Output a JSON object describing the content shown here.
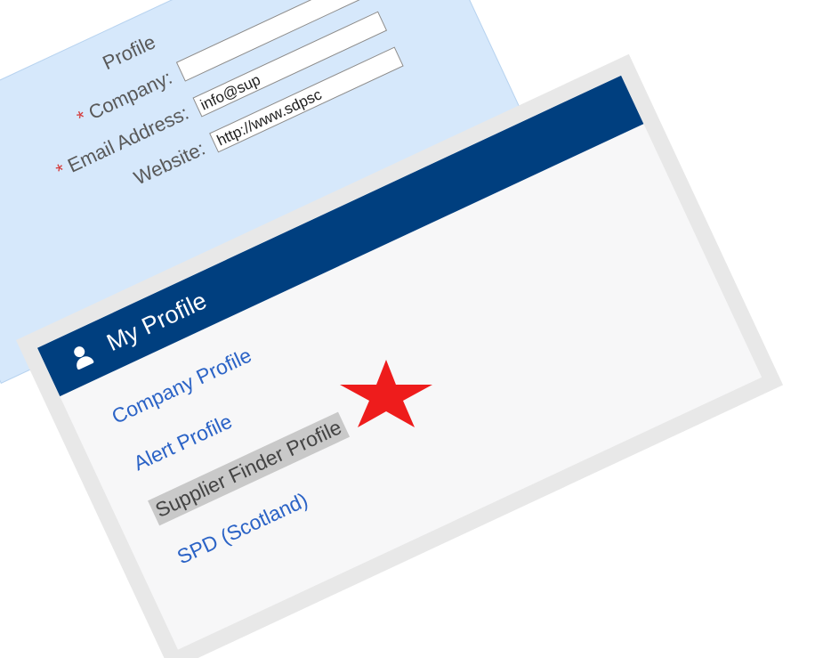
{
  "background_form": {
    "rows": [
      {
        "label": "Profile",
        "required": false,
        "value": ""
      },
      {
        "label": "Company:",
        "required": true,
        "value": ""
      },
      {
        "label": "Email Address:",
        "required": true,
        "value": "info@sup"
      },
      {
        "label": "Website:",
        "required": false,
        "value": "http://www.sdpsc"
      }
    ],
    "required_marker": "*"
  },
  "profile_panel": {
    "title": "My Profile",
    "icon": "user-icon",
    "items": [
      {
        "label": "Company Profile",
        "active": false
      },
      {
        "label": "Alert Profile",
        "active": false
      },
      {
        "label": "Supplier Finder Profile",
        "active": true
      },
      {
        "label": "SPD (Scotland)",
        "active": false
      }
    ]
  },
  "annotation": {
    "shape": "star",
    "color": "#ee1c1c"
  },
  "colors": {
    "header": "#003f7f",
    "link": "#2b63c6",
    "form_bg": "#d6e8fb",
    "panel_frame": "#e8e8e8"
  }
}
